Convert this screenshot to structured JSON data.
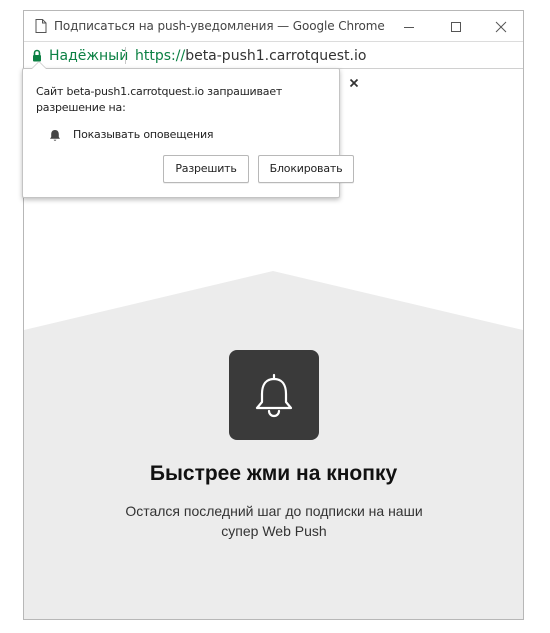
{
  "window": {
    "title": "Подписаться на push-уведомления — Google Chrome"
  },
  "addressbar": {
    "secure_label": "Надёжный",
    "url_scheme": "https://",
    "url_host": "beta-push1.carrotquest.io"
  },
  "permission_popup": {
    "message": "Сайт beta-push1.carrotquest.io запрашивает разрешение на:",
    "permission_label": "Показывать оповещения",
    "allow_label": "Разрешить",
    "block_label": "Блокировать",
    "close_icon": "close-icon",
    "permission_icon": "bell-icon"
  },
  "page": {
    "headline": "Быстрее жми на кнопку",
    "subtext": "Остался последний шаг до подписки на наши супер Web Push",
    "bell_icon": "bell-icon"
  },
  "colors": {
    "secure_green": "#0b8043",
    "tile_dark": "#3a3a3a",
    "panel_gray": "#ececec"
  }
}
